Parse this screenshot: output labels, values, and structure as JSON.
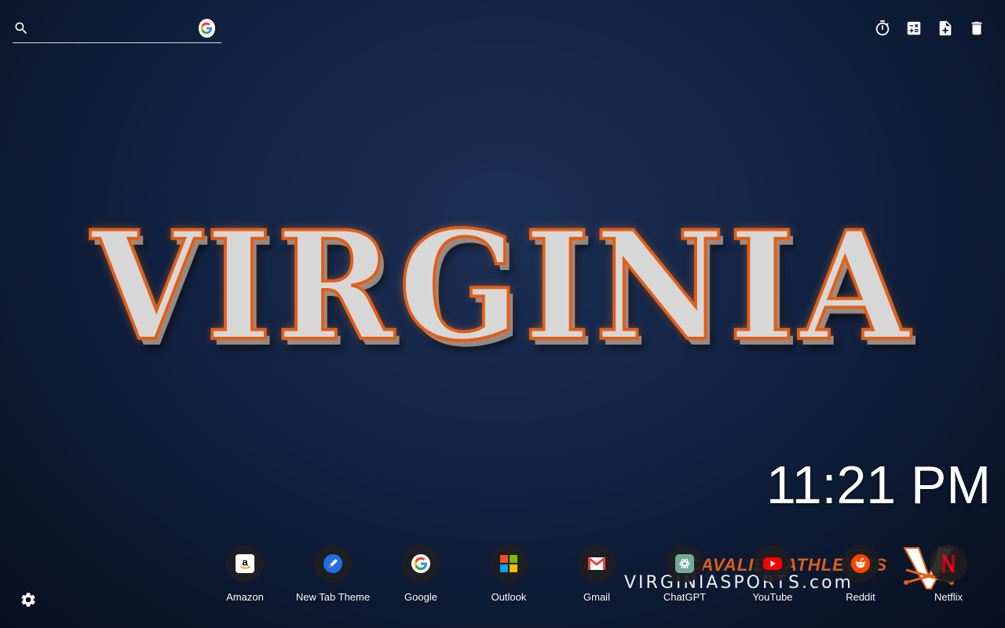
{
  "search": {
    "placeholder": "",
    "value": "",
    "engine_icon": "google-icon"
  },
  "toolbar": {
    "items": [
      {
        "icon": "timer-icon",
        "name": "timer"
      },
      {
        "icon": "calculator-icon",
        "name": "calculator"
      },
      {
        "icon": "note-add-icon",
        "name": "new-note"
      },
      {
        "icon": "delete-icon",
        "name": "delete"
      }
    ]
  },
  "wallpaper": {
    "title": "VIRGINIA",
    "brand_text": "CAVALIER ATHLETICS",
    "site_text": "VIRGINIASPORTS.com",
    "logo_icon": "uva-v-sabres-logo",
    "colors": {
      "orange": "#e25e17",
      "navy": "#142444"
    }
  },
  "clock": {
    "time": "11:21 PM"
  },
  "shortcuts": [
    {
      "label": "Amazon",
      "icon": "amazon-icon"
    },
    {
      "label": "New Tab Theme",
      "icon": "brush-icon"
    },
    {
      "label": "Google",
      "icon": "google-icon"
    },
    {
      "label": "Outlook",
      "icon": "microsoft-icon"
    },
    {
      "label": "Gmail",
      "icon": "gmail-icon"
    },
    {
      "label": "ChatGPT",
      "icon": "chatgpt-icon"
    },
    {
      "label": "YouTube",
      "icon": "youtube-icon"
    },
    {
      "label": "Reddit",
      "icon": "reddit-icon"
    },
    {
      "label": "Netflix",
      "icon": "netflix-icon"
    }
  ],
  "settings": {
    "icon": "gear-icon"
  }
}
